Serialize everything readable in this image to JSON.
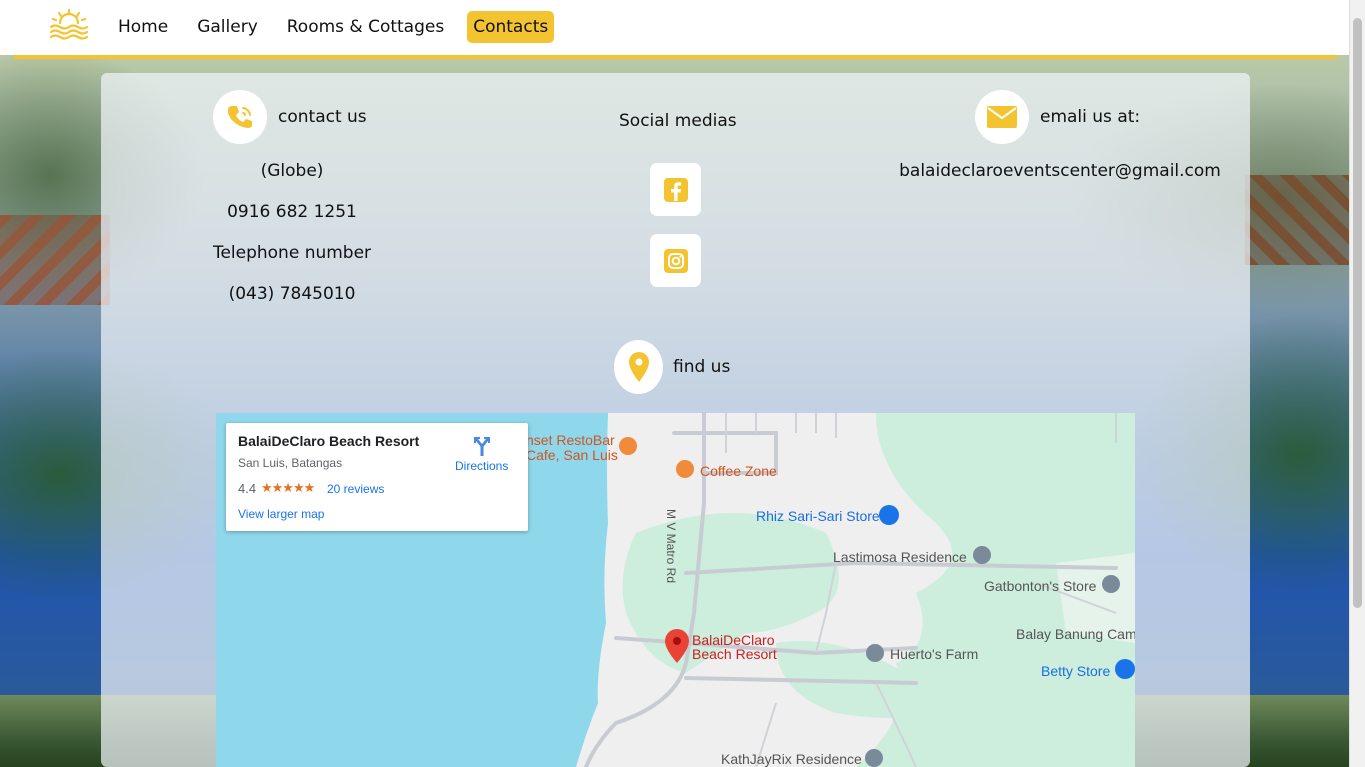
{
  "nav": {
    "items": [
      {
        "label": "Home",
        "active": false
      },
      {
        "label": "Gallery",
        "active": false
      },
      {
        "label": "Rooms & Cottages",
        "active": false
      },
      {
        "label": "Contacts",
        "active": true
      }
    ]
  },
  "theme": {
    "accent": "#f4c430"
  },
  "contact": {
    "heading": "contact us",
    "icon": "phone-icon",
    "network": "(Globe)",
    "mobile": "0916 682 1251",
    "telephone_label": "Telephone number",
    "telephone": "(043) 7845010"
  },
  "social": {
    "heading": "Social medias",
    "items": [
      {
        "icon": "facebook-icon"
      },
      {
        "icon": "instagram-icon"
      }
    ]
  },
  "email": {
    "heading": "emali us at:",
    "icon": "envelope-icon",
    "address": "balaideclaroeventscenter@gmail.com"
  },
  "find": {
    "heading": "find us",
    "icon": "location-pin-icon"
  },
  "map": {
    "place_name": "BalaiDeClaro Beach Resort",
    "place_address": "San Luis, Batangas",
    "rating": "4.4",
    "stars": "★★★★★",
    "reviews": "20 reviews",
    "larger_map": "View larger map",
    "directions": "Directions",
    "road": "M V Matro Rd",
    "pois": {
      "resto_line1": "nset RestoBar",
      "resto_line2": "Cafe, San Luis",
      "coffee": "Coffee Zone",
      "rhiz": "Rhiz Sari-Sari Store",
      "lastimosa": "Lastimosa Residence",
      "gatbonton": "Gatbonton's Store",
      "balay": "Balay Banung Camp",
      "resort_line1": "BalaiDeClaro",
      "resort_line2": "Beach Resort",
      "huerto": "Huerto's Farm",
      "betty": "Betty Store",
      "kathjay": "KathJayRix Residence"
    }
  }
}
